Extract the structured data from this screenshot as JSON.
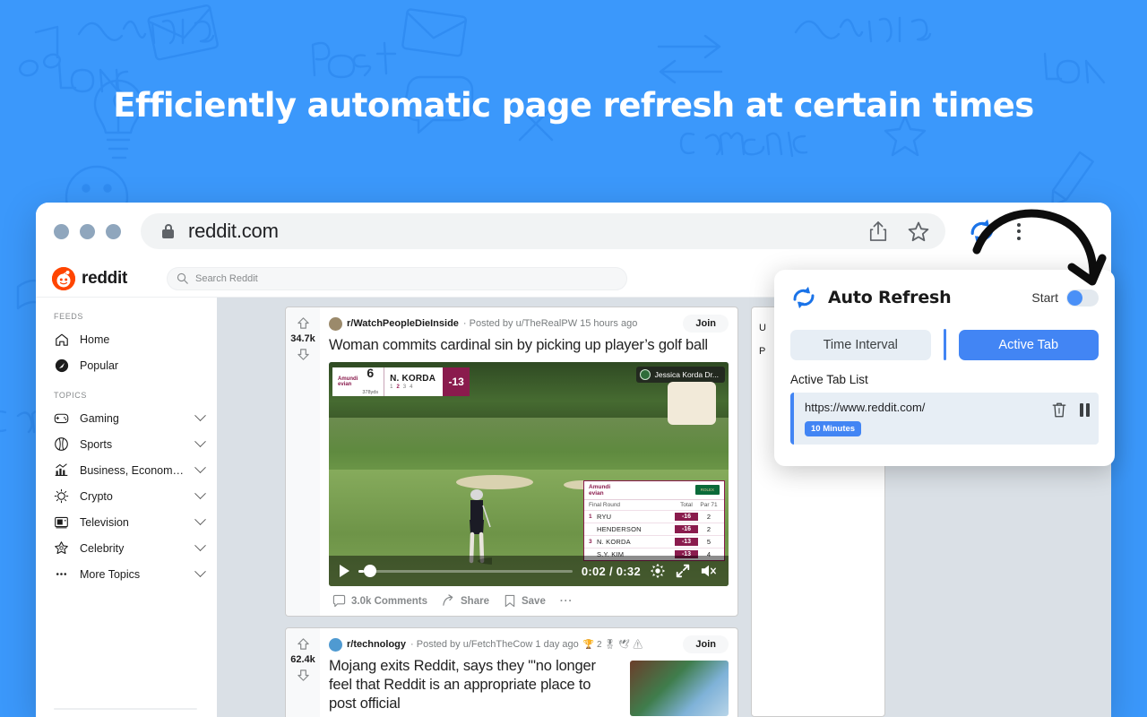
{
  "promo": {
    "headline": "Efficiently automatic page refresh at certain times",
    "background_color": "#3b98fb"
  },
  "browser": {
    "address_bar": {
      "url": "reddit.com",
      "lock_icon": "lock-icon"
    },
    "toolbar_icons": [
      "share-icon",
      "bookmark-star-icon",
      "auto-refresh-extension-icon",
      "kebab-menu-icon"
    ]
  },
  "reddit": {
    "logo_text": "reddit",
    "search": {
      "placeholder": "Search Reddit"
    },
    "sidebar": {
      "feeds_heading": "FEEDS",
      "feeds": [
        {
          "label": "Home",
          "icon": "home-icon"
        },
        {
          "label": "Popular",
          "icon": "popular-icon"
        }
      ],
      "topics_heading": "TOPICS",
      "topics": [
        {
          "label": "Gaming",
          "icon": "gamepad-icon"
        },
        {
          "label": "Sports",
          "icon": "sports-ball-icon"
        },
        {
          "label": "Business, Economics, a...",
          "icon": "chart-icon"
        },
        {
          "label": "Crypto",
          "icon": "crypto-icon"
        },
        {
          "label": "Television",
          "icon": "television-icon"
        },
        {
          "label": "Celebrity",
          "icon": "star-badge-icon"
        },
        {
          "label": "More Topics",
          "icon": "ellipsis-icon"
        }
      ]
    },
    "posts": [
      {
        "subreddit": "r/WatchPeopleDieInside",
        "meta": "· Posted by u/TheRealPW 15 hours ago",
        "title": "Woman commits cardinal sin by picking up player’s golf ball",
        "votes": "34.7k",
        "join_label": "Join",
        "comments": "3.0k Comments",
        "share": "Share",
        "save": "Save",
        "more": "···",
        "video": {
          "time": "0:02 / 0:32",
          "player_chip": "Jessica Korda Dr...",
          "scorebug": {
            "brand_line1": "Amundi",
            "brand_line2": "evian",
            "hole": "6",
            "yards": "378yds",
            "player": "N. KORDA",
            "score": "-13",
            "shots": [
              "1",
              "2",
              "3",
              "4"
            ],
            "active_shot": "2"
          },
          "leaderboard": {
            "brand_line1": "Amundi",
            "brand_line2": "evian",
            "sponsor": "ROLEX",
            "round": "Final Round",
            "col_total": "Total",
            "col_par": "Par 71",
            "rows": [
              {
                "pos": "1",
                "name": "RYU",
                "total": "-16",
                "par": "2"
              },
              {
                "pos": "",
                "name": "HENDERSON",
                "total": "-16",
                "par": "2"
              },
              {
                "pos": "3",
                "name": "N. KORDA",
                "total": "-13",
                "par": "5"
              },
              {
                "pos": "",
                "name": "S.Y. KIM",
                "total": "-13",
                "par": "4"
              }
            ]
          }
        }
      },
      {
        "subreddit": "r/technology",
        "meta": "· Posted by u/FetchTheCow 1 day ago",
        "awards": "🏆 2 🎖 🕊 ⚠",
        "title": "Mojang exits Reddit, says they '\"no longer feel that Reddit is an appropriate place to post official",
        "votes": "62.4k",
        "join_label": "Join"
      }
    ],
    "right_card": {
      "line1": "U",
      "line2": "P"
    }
  },
  "extension_popup": {
    "title": "Auto Refresh",
    "logo_icon": "auto-refresh-icon",
    "start_label": "Start",
    "toggle_state": "off",
    "tabs": [
      {
        "label": "Time Interval",
        "active": false
      },
      {
        "label": "Active Tab",
        "active": true
      }
    ],
    "list_title": "Active Tab List",
    "items": [
      {
        "url": "https://www.reddit.com/",
        "interval_badge": "10 Minutes",
        "delete_icon": "trash-icon",
        "pause_icon": "pause-icon"
      }
    ],
    "accent_color": "#4285f4"
  }
}
